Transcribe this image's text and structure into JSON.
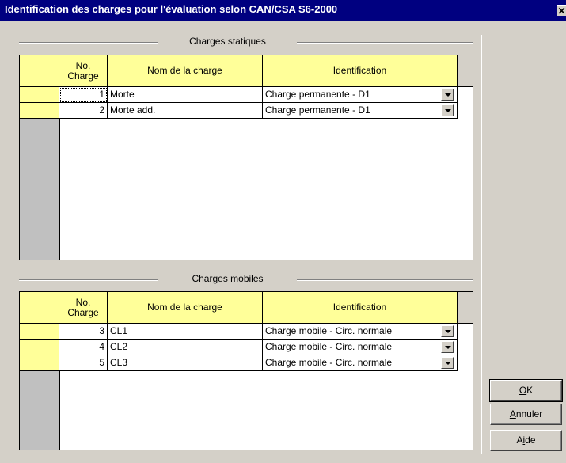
{
  "window": {
    "title": "Identification des charges pour l'évaluation selon CAN/CSA S6-2000",
    "close_glyph": "✕"
  },
  "static": {
    "label": "Charges statiques",
    "headers": {
      "no": "No. Charge",
      "nom": "Nom de la charge",
      "id": "Identification"
    },
    "rows": [
      {
        "no": "1",
        "nom": "Morte",
        "id": "Charge permanente - D1"
      },
      {
        "no": "2",
        "nom": "Morte add.",
        "id": "Charge permanente - D1"
      }
    ]
  },
  "mobile": {
    "label": "Charges mobiles",
    "headers": {
      "no": "No. Charge",
      "nom": "Nom de la charge",
      "id": "Identification"
    },
    "rows": [
      {
        "no": "3",
        "nom": "CL1",
        "id": "Charge mobile - Circ. normale"
      },
      {
        "no": "4",
        "nom": "CL2",
        "id": "Charge mobile - Circ. normale"
      },
      {
        "no": "5",
        "nom": "CL3",
        "id": "Charge mobile - Circ. normale"
      }
    ]
  },
  "buttons": {
    "ok": {
      "accel": "O",
      "rest": "K"
    },
    "annuler": {
      "accel": "A",
      "rest": "nnuler"
    },
    "aide": {
      "pre": "A",
      "accel": "i",
      "rest": "de"
    }
  }
}
